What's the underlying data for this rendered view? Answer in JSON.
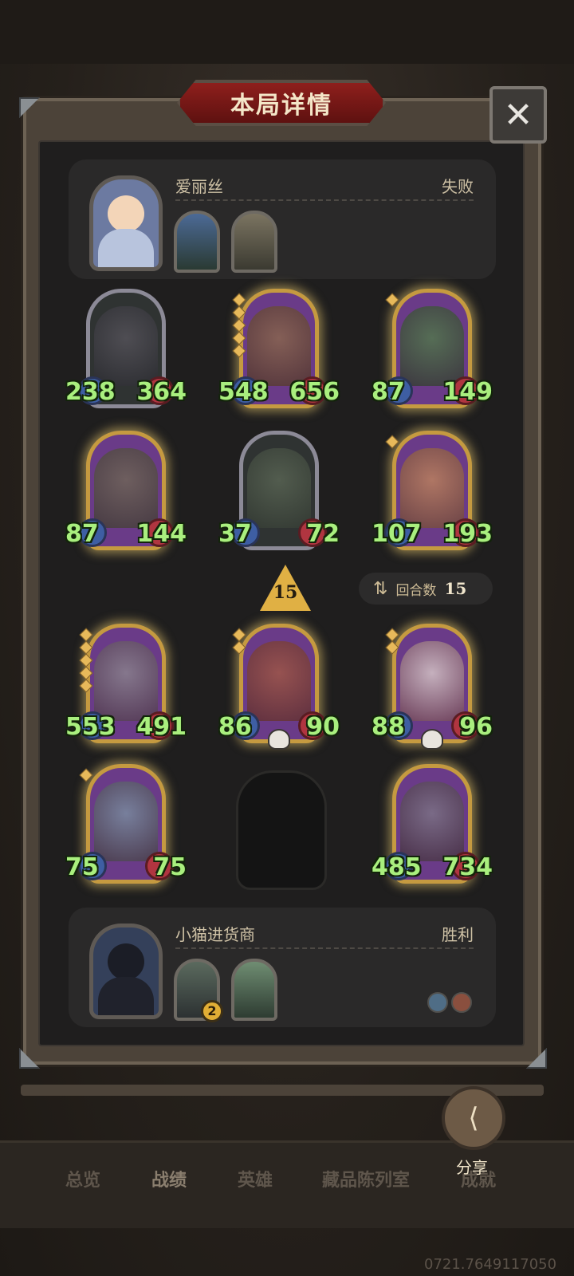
{
  "header": {
    "title": "本局详情",
    "close_icon": "close-icon"
  },
  "opponent": {
    "name": "爱丽丝",
    "result": "失败",
    "items": [
      {
        "icon": "spell-card-icon"
      },
      {
        "icon": "spell-card-icon"
      }
    ]
  },
  "board": {
    "rows": [
      [
        {
          "atk": "238",
          "hp": "364",
          "stars": 0,
          "style": "grey"
        },
        {
          "atk": "548",
          "hp": "656",
          "stars": 5,
          "style": "gold"
        },
        {
          "atk": "87",
          "hp": "149",
          "stars": 1,
          "style": "gold"
        }
      ],
      [
        {
          "atk": "87",
          "hp": "144",
          "stars": 0,
          "style": "gold"
        },
        {
          "atk": "37",
          "hp": "72",
          "stars": 0,
          "style": "grey"
        },
        {
          "atk": "107",
          "hp": "193",
          "stars": 1,
          "style": "gold"
        }
      ],
      [
        {
          "atk": "553",
          "hp": "491",
          "stars": 5,
          "style": "gold"
        },
        {
          "atk": "86",
          "hp": "90",
          "stars": 2,
          "style": "gold"
        },
        {
          "atk": "88",
          "hp": "96",
          "stars": 2,
          "style": "gold"
        }
      ],
      [
        {
          "atk": "75",
          "hp": "75",
          "stars": 1,
          "style": "gold"
        },
        null,
        {
          "atk": "485",
          "hp": "734",
          "stars": 0,
          "style": "gold"
        }
      ]
    ],
    "tier": "15",
    "rounds_label": "回合数",
    "rounds_value": "15"
  },
  "player": {
    "name": "小猫进货商",
    "result": "胜利",
    "items": [
      {
        "icon": "bottles-icon",
        "badge": "2"
      },
      {
        "icon": "hand-icon"
      }
    ]
  },
  "share": {
    "label": "分享"
  },
  "nav": {
    "tabs": [
      "总览",
      "战绩",
      "英雄",
      "藏品陈列室",
      "成就"
    ]
  },
  "footer": {
    "uid": "0721.7649117050"
  }
}
